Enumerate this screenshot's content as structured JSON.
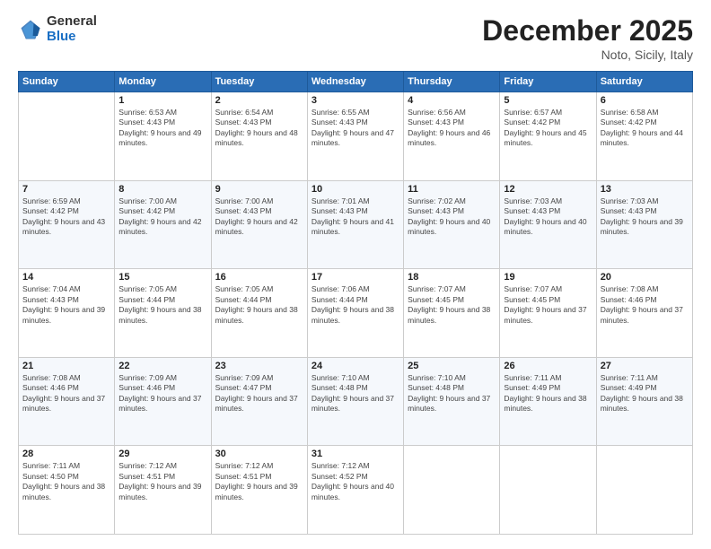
{
  "header": {
    "logo_general": "General",
    "logo_blue": "Blue",
    "title": "December 2025",
    "location": "Noto, Sicily, Italy"
  },
  "days": [
    "Sunday",
    "Monday",
    "Tuesday",
    "Wednesday",
    "Thursday",
    "Friday",
    "Saturday"
  ],
  "weeks": [
    [
      null,
      {
        "date": "1",
        "sunrise": "Sunrise: 6:53 AM",
        "sunset": "Sunset: 4:43 PM",
        "daylight": "Daylight: 9 hours and 49 minutes."
      },
      {
        "date": "2",
        "sunrise": "Sunrise: 6:54 AM",
        "sunset": "Sunset: 4:43 PM",
        "daylight": "Daylight: 9 hours and 48 minutes."
      },
      {
        "date": "3",
        "sunrise": "Sunrise: 6:55 AM",
        "sunset": "Sunset: 4:43 PM",
        "daylight": "Daylight: 9 hours and 47 minutes."
      },
      {
        "date": "4",
        "sunrise": "Sunrise: 6:56 AM",
        "sunset": "Sunset: 4:43 PM",
        "daylight": "Daylight: 9 hours and 46 minutes."
      },
      {
        "date": "5",
        "sunrise": "Sunrise: 6:57 AM",
        "sunset": "Sunset: 4:42 PM",
        "daylight": "Daylight: 9 hours and 45 minutes."
      },
      {
        "date": "6",
        "sunrise": "Sunrise: 6:58 AM",
        "sunset": "Sunset: 4:42 PM",
        "daylight": "Daylight: 9 hours and 44 minutes."
      }
    ],
    [
      {
        "date": "7",
        "sunrise": "Sunrise: 6:59 AM",
        "sunset": "Sunset: 4:42 PM",
        "daylight": "Daylight: 9 hours and 43 minutes."
      },
      {
        "date": "8",
        "sunrise": "Sunrise: 7:00 AM",
        "sunset": "Sunset: 4:42 PM",
        "daylight": "Daylight: 9 hours and 42 minutes."
      },
      {
        "date": "9",
        "sunrise": "Sunrise: 7:00 AM",
        "sunset": "Sunset: 4:43 PM",
        "daylight": "Daylight: 9 hours and 42 minutes."
      },
      {
        "date": "10",
        "sunrise": "Sunrise: 7:01 AM",
        "sunset": "Sunset: 4:43 PM",
        "daylight": "Daylight: 9 hours and 41 minutes."
      },
      {
        "date": "11",
        "sunrise": "Sunrise: 7:02 AM",
        "sunset": "Sunset: 4:43 PM",
        "daylight": "Daylight: 9 hours and 40 minutes."
      },
      {
        "date": "12",
        "sunrise": "Sunrise: 7:03 AM",
        "sunset": "Sunset: 4:43 PM",
        "daylight": "Daylight: 9 hours and 40 minutes."
      },
      {
        "date": "13",
        "sunrise": "Sunrise: 7:03 AM",
        "sunset": "Sunset: 4:43 PM",
        "daylight": "Daylight: 9 hours and 39 minutes."
      }
    ],
    [
      {
        "date": "14",
        "sunrise": "Sunrise: 7:04 AM",
        "sunset": "Sunset: 4:43 PM",
        "daylight": "Daylight: 9 hours and 39 minutes."
      },
      {
        "date": "15",
        "sunrise": "Sunrise: 7:05 AM",
        "sunset": "Sunset: 4:44 PM",
        "daylight": "Daylight: 9 hours and 38 minutes."
      },
      {
        "date": "16",
        "sunrise": "Sunrise: 7:05 AM",
        "sunset": "Sunset: 4:44 PM",
        "daylight": "Daylight: 9 hours and 38 minutes."
      },
      {
        "date": "17",
        "sunrise": "Sunrise: 7:06 AM",
        "sunset": "Sunset: 4:44 PM",
        "daylight": "Daylight: 9 hours and 38 minutes."
      },
      {
        "date": "18",
        "sunrise": "Sunrise: 7:07 AM",
        "sunset": "Sunset: 4:45 PM",
        "daylight": "Daylight: 9 hours and 38 minutes."
      },
      {
        "date": "19",
        "sunrise": "Sunrise: 7:07 AM",
        "sunset": "Sunset: 4:45 PM",
        "daylight": "Daylight: 9 hours and 37 minutes."
      },
      {
        "date": "20",
        "sunrise": "Sunrise: 7:08 AM",
        "sunset": "Sunset: 4:46 PM",
        "daylight": "Daylight: 9 hours and 37 minutes."
      }
    ],
    [
      {
        "date": "21",
        "sunrise": "Sunrise: 7:08 AM",
        "sunset": "Sunset: 4:46 PM",
        "daylight": "Daylight: 9 hours and 37 minutes."
      },
      {
        "date": "22",
        "sunrise": "Sunrise: 7:09 AM",
        "sunset": "Sunset: 4:46 PM",
        "daylight": "Daylight: 9 hours and 37 minutes."
      },
      {
        "date": "23",
        "sunrise": "Sunrise: 7:09 AM",
        "sunset": "Sunset: 4:47 PM",
        "daylight": "Daylight: 9 hours and 37 minutes."
      },
      {
        "date": "24",
        "sunrise": "Sunrise: 7:10 AM",
        "sunset": "Sunset: 4:48 PM",
        "daylight": "Daylight: 9 hours and 37 minutes."
      },
      {
        "date": "25",
        "sunrise": "Sunrise: 7:10 AM",
        "sunset": "Sunset: 4:48 PM",
        "daylight": "Daylight: 9 hours and 37 minutes."
      },
      {
        "date": "26",
        "sunrise": "Sunrise: 7:11 AM",
        "sunset": "Sunset: 4:49 PM",
        "daylight": "Daylight: 9 hours and 38 minutes."
      },
      {
        "date": "27",
        "sunrise": "Sunrise: 7:11 AM",
        "sunset": "Sunset: 4:49 PM",
        "daylight": "Daylight: 9 hours and 38 minutes."
      }
    ],
    [
      {
        "date": "28",
        "sunrise": "Sunrise: 7:11 AM",
        "sunset": "Sunset: 4:50 PM",
        "daylight": "Daylight: 9 hours and 38 minutes."
      },
      {
        "date": "29",
        "sunrise": "Sunrise: 7:12 AM",
        "sunset": "Sunset: 4:51 PM",
        "daylight": "Daylight: 9 hours and 39 minutes."
      },
      {
        "date": "30",
        "sunrise": "Sunrise: 7:12 AM",
        "sunset": "Sunset: 4:51 PM",
        "daylight": "Daylight: 9 hours and 39 minutes."
      },
      {
        "date": "31",
        "sunrise": "Sunrise: 7:12 AM",
        "sunset": "Sunset: 4:52 PM",
        "daylight": "Daylight: 9 hours and 40 minutes."
      },
      null,
      null,
      null
    ]
  ]
}
